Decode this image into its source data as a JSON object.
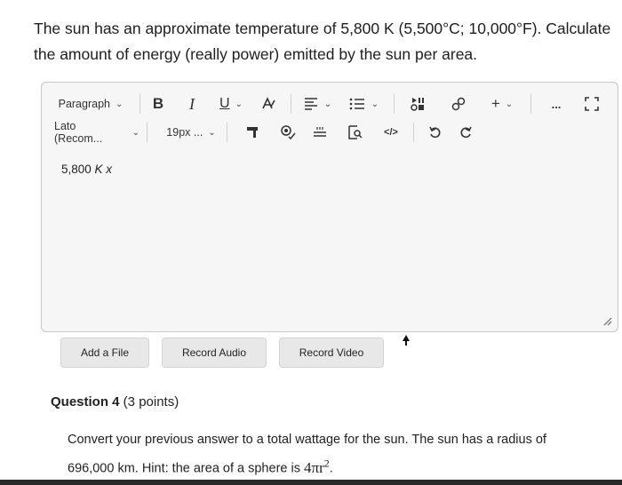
{
  "question": {
    "text_line1": "The sun has an approximate temperature of 5,800 K (5,500°C; 10,000°F). Calculate",
    "text_line2": "the amount of energy (really power) emitted by the sun per area."
  },
  "toolbar": {
    "paragraph_label": "Paragraph",
    "bold_label": "B",
    "italic_label": "I",
    "underline_label": "U",
    "font_label": "Lato (Recom...",
    "size_label": "19px ...",
    "more_label": "...",
    "add_label": "+"
  },
  "editor": {
    "content_prefix": "5,800 ",
    "content_italic": "K x"
  },
  "buttons": {
    "add_file": "Add a File",
    "record_audio": "Record Audio",
    "record_video": "Record Video"
  },
  "question4": {
    "title": "Question 4",
    "points": " (3 points)",
    "text_line1": "Convert your previous answer to a total wattage for the sun. The sun has a radius of",
    "text_line2": "696,000 km. Hint: the area of a sphere is ",
    "formula_base": "4πr",
    "formula_exp": "2",
    "formula_end": "."
  },
  "colors": {
    "editor_bg": "#f6f6f6",
    "button_bg": "#e8e8e8",
    "border": "#c8c8c8"
  }
}
